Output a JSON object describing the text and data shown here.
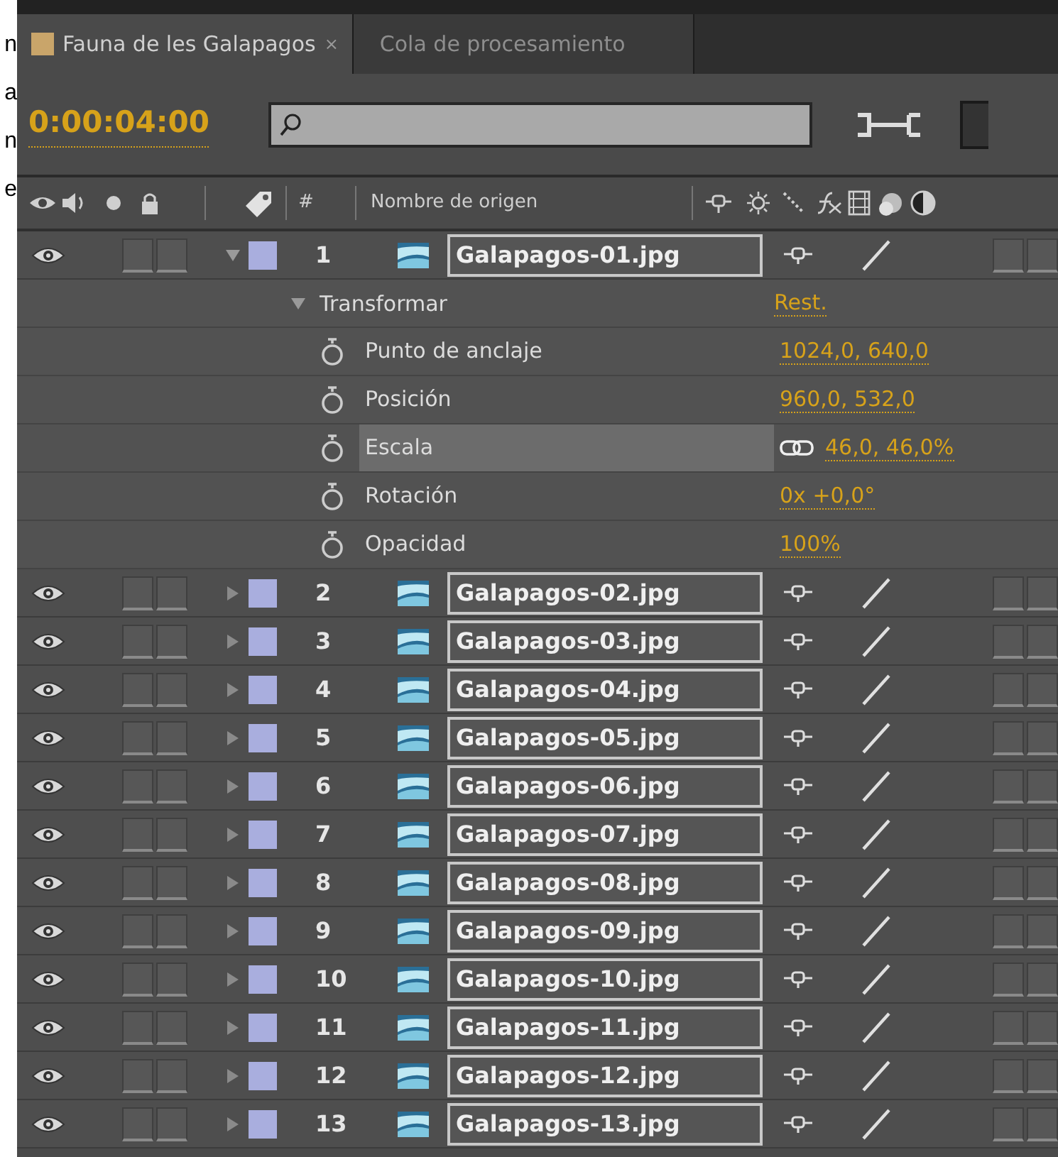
{
  "margin_letters": [
    "n",
    "a",
    "n",
    "e"
  ],
  "tabs": [
    {
      "label": "Fauna de les Galapagos",
      "selected": true,
      "close": "×"
    },
    {
      "label": "Cola de procesamiento",
      "selected": false
    }
  ],
  "timecode": "0:00:04:00",
  "columns": {
    "number": "#",
    "source_name": "Nombre de origen"
  },
  "layers": [
    {
      "number": "1",
      "name": "Galapagos-01.jpg",
      "visible": true,
      "expanded": true,
      "children": [
        {
          "name": "Transformar",
          "value": "Rest.",
          "expanded": true,
          "children": [
            {
              "name": "Punto de anclaje",
              "value": "1024,0, 640,0",
              "selected": false,
              "linked": false
            },
            {
              "name": "Posición",
              "value": "960,0, 532,0",
              "selected": false,
              "linked": false
            },
            {
              "name": "Escala",
              "value": "46,0, 46,0%",
              "selected": true,
              "linked": true
            },
            {
              "name": "Rotación",
              "value": "0x +0,0°",
              "selected": false,
              "linked": false
            },
            {
              "name": "Opacidad",
              "value": "100%",
              "selected": false,
              "linked": false
            }
          ]
        }
      ]
    },
    {
      "number": "2",
      "name": "Galapagos-02.jpg",
      "visible": true,
      "expanded": false
    },
    {
      "number": "3",
      "name": "Galapagos-03.jpg",
      "visible": true,
      "expanded": false
    },
    {
      "number": "4",
      "name": "Galapagos-04.jpg",
      "visible": true,
      "expanded": false
    },
    {
      "number": "5",
      "name": "Galapagos-05.jpg",
      "visible": true,
      "expanded": false
    },
    {
      "number": "6",
      "name": "Galapagos-06.jpg",
      "visible": true,
      "expanded": false
    },
    {
      "number": "7",
      "name": "Galapagos-07.jpg",
      "visible": true,
      "expanded": false
    },
    {
      "number": "8",
      "name": "Galapagos-08.jpg",
      "visible": true,
      "expanded": false
    },
    {
      "number": "9",
      "name": "Galapagos-09.jpg",
      "visible": true,
      "expanded": false
    },
    {
      "number": "10",
      "name": "Galapagos-10.jpg",
      "visible": true,
      "expanded": false
    },
    {
      "number": "11",
      "name": "Galapagos-11.jpg",
      "visible": true,
      "expanded": false
    },
    {
      "number": "12",
      "name": "Galapagos-12.jpg",
      "visible": true,
      "expanded": false
    },
    {
      "number": "13",
      "name": "Galapagos-13.jpg",
      "visible": true,
      "expanded": false
    }
  ]
}
